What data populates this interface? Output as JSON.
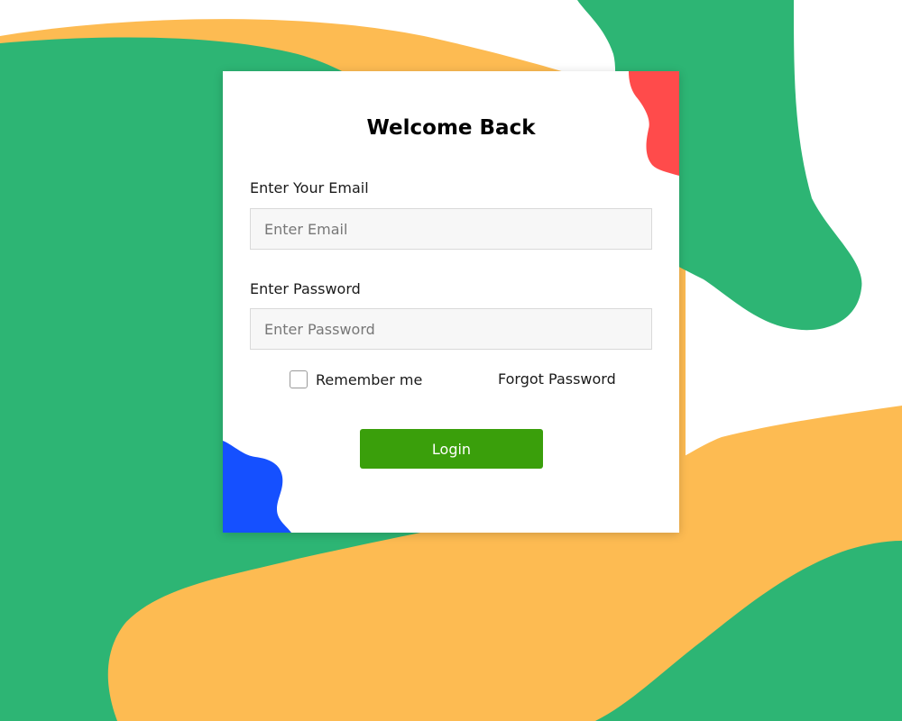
{
  "login_form": {
    "title": "Welcome Back",
    "email": {
      "label": "Enter Your Email",
      "placeholder": "Enter Email",
      "value": ""
    },
    "password": {
      "label": "Enter Password",
      "placeholder": "Enter Password",
      "value": ""
    },
    "remember_me": {
      "label": "Remember me",
      "checked": false
    },
    "forgot_password_label": "Forgot Password",
    "login_button_label": "Login"
  },
  "colors": {
    "background_green": "#2db574",
    "background_yellow": "#fdbb52",
    "accent_red": "#ff4b4b",
    "accent_blue": "#1550ff",
    "button_green": "#3a9f0b",
    "card_background": "#ffffff"
  }
}
